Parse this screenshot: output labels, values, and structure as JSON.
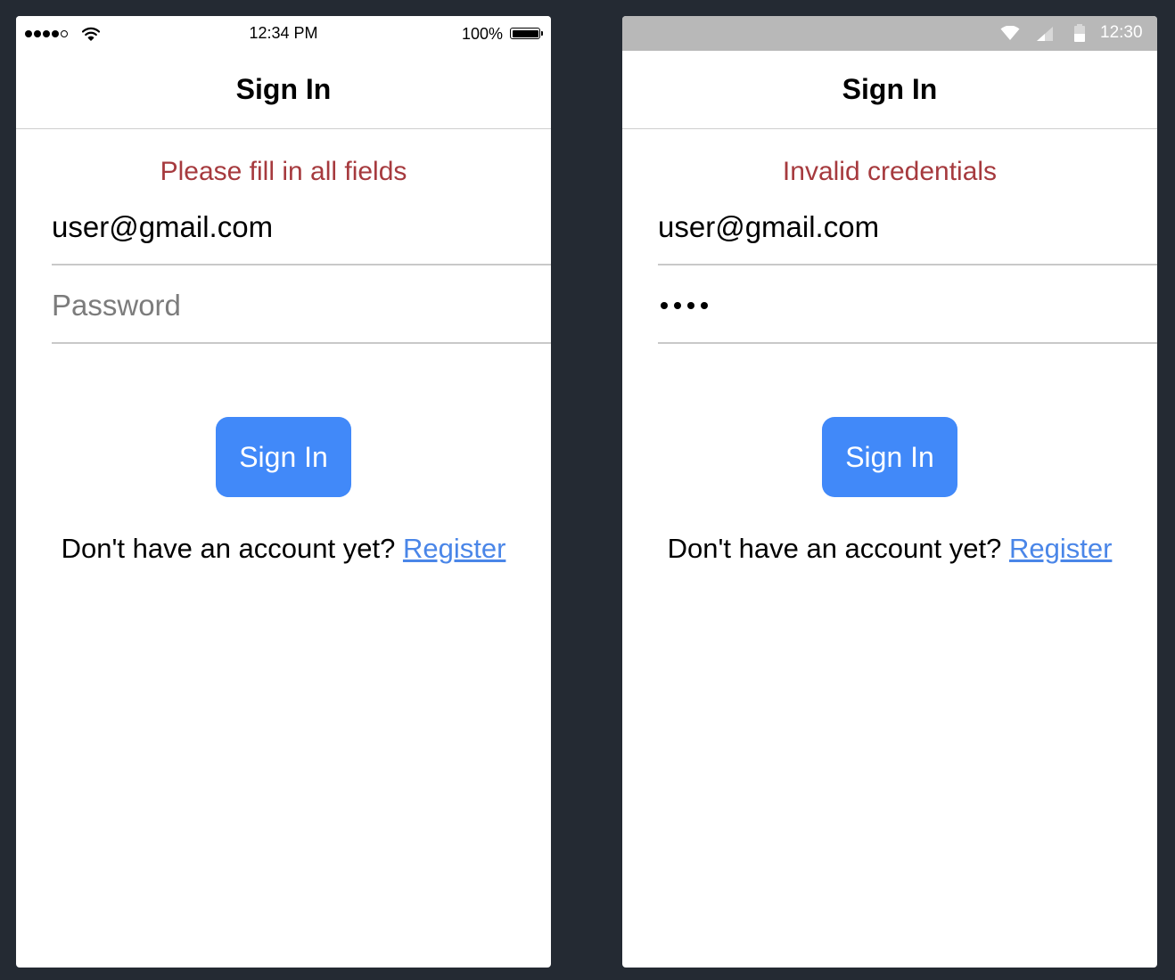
{
  "ios": {
    "status_bar": {
      "time": "12:34 PM",
      "battery": "100%",
      "signal_bars_filled": 4,
      "signal_bars_total": 5
    },
    "title": "Sign In",
    "error": "Please fill in all fields",
    "email_value": "user@gmail.com",
    "password_placeholder": "Password",
    "signin_label": "Sign In",
    "register_prompt": "Don't have an account yet? ",
    "register_link": "Register"
  },
  "android": {
    "status_bar": {
      "time": "12:30",
      "battery_level": 0.5
    },
    "title": "Sign In",
    "error": "Invalid credentials",
    "email_value": "user@gmail.com",
    "password_masked_length": 4,
    "signin_label": "Sign In",
    "register_prompt": "Don't have an account yet? ",
    "register_link": "Register"
  },
  "colors": {
    "background": "#242a33",
    "error": "#a63a3e",
    "button": "#4189f9",
    "link": "#4a86e8",
    "android_status_bar": "#b8b8b8"
  }
}
